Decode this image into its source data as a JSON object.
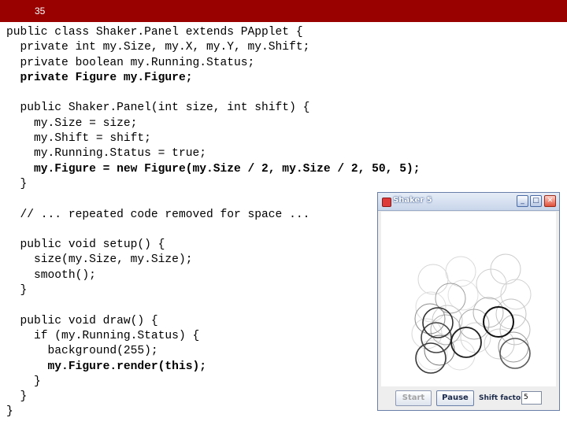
{
  "slide": {
    "number": "35"
  },
  "code_lines": [
    {
      "text": "public class Shaker.Panel extends PApplet {",
      "bold": false
    },
    {
      "text": "  private int my.Size, my.X, my.Y, my.Shift;",
      "bold": false
    },
    {
      "text": "  private boolean my.Running.Status;",
      "bold": false
    },
    {
      "text": "  private Figure my.Figure;",
      "bold": true
    },
    {
      "text": "",
      "bold": false
    },
    {
      "text": "  public Shaker.Panel(int size, int shift) {",
      "bold": false
    },
    {
      "text": "    my.Size = size;",
      "bold": false
    },
    {
      "text": "    my.Shift = shift;",
      "bold": false
    },
    {
      "text": "    my.Running.Status = true;",
      "bold": false
    },
    {
      "text": "    my.Figure = new Figure(my.Size / 2, my.Size / 2, 50, 5);",
      "bold": true
    },
    {
      "text": "  }",
      "bold": false
    },
    {
      "text": "",
      "bold": false
    },
    {
      "text": "  // ... repeated code removed for space ...",
      "bold": false
    },
    {
      "text": "",
      "bold": false
    },
    {
      "text": "  public void setup() {",
      "bold": false
    },
    {
      "text": "    size(my.Size, my.Size);",
      "bold": false
    },
    {
      "text": "    smooth();",
      "bold": false
    },
    {
      "text": "  }",
      "bold": false
    },
    {
      "text": "",
      "bold": false
    },
    {
      "text": "  public void draw() {",
      "bold": false
    },
    {
      "text": "    if (my.Running.Status) {",
      "bold": false
    },
    {
      "text": "      background(255);",
      "bold": false
    },
    {
      "text": "      my.Figure.render(this);",
      "bold": true
    },
    {
      "text": "    }",
      "bold": false
    },
    {
      "text": "  }",
      "bold": false
    },
    {
      "text": "}",
      "bold": false
    }
  ],
  "window": {
    "title": "Shaker 5",
    "start_label": "Start",
    "pause_label": "Pause",
    "shift_label": "Shift factor:",
    "shift_value": "5",
    "icons": {
      "app": "java-cup-icon",
      "minimize": "minimize-icon",
      "maximize": "maximize-icon",
      "close": "close-icon"
    },
    "colors": {
      "titlebar": "#c8d5ea",
      "header": "#990000"
    }
  }
}
